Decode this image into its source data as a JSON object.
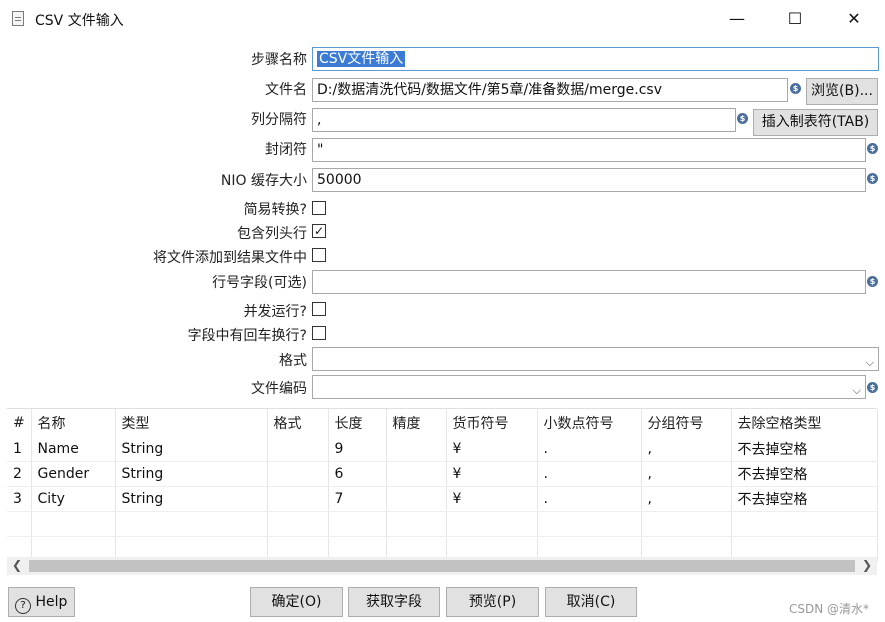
{
  "window": {
    "title": "CSV 文件输入",
    "minimize": "—",
    "maximize": "☐",
    "close": "✕"
  },
  "form": {
    "step_name_label": "步骤名称",
    "step_name_value": "CSV文件输入",
    "filename_label": "文件名",
    "filename_value": "D:/数据清洗代码/数据文件/第5章/准备数据/merge.csv",
    "browse_label": "浏览(B)...",
    "delimiter_label": "列分隔符",
    "delimiter_value": ",",
    "insert_tab_label": "插入制表符(TAB)",
    "enclosure_label": "封闭符",
    "enclosure_value": "\"",
    "nio_label": "NIO 缓存大小",
    "nio_value": "50000",
    "lazy_label": "简易转换?",
    "lazy_checked": false,
    "header_label": "包含列头行",
    "header_checked": true,
    "addfile_label": "将文件添加到结果文件中",
    "addfile_checked": false,
    "rownum_label": "行号字段(可选)",
    "rownum_value": "",
    "parallel_label": "并发运行?",
    "parallel_checked": false,
    "newline_label": "字段中有回车换行?",
    "newline_checked": false,
    "format_label": "格式",
    "format_value": "",
    "encoding_label": "文件编码",
    "encoding_value": ""
  },
  "grid": {
    "columns": [
      "#",
      "名称",
      "类型",
      "格式",
      "长度",
      "精度",
      "货币符号",
      "小数点符号",
      "分组符号",
      "去除空格类型"
    ],
    "rows": [
      [
        "1",
        "Name",
        "String",
        "",
        "9",
        "",
        "¥",
        ".",
        ",",
        "不去掉空格"
      ],
      [
        "2",
        "Gender",
        "String",
        "",
        "6",
        "",
        "¥",
        ".",
        ",",
        "不去掉空格"
      ],
      [
        "3",
        "City",
        "String",
        "",
        "7",
        "",
        "¥",
        ".",
        ",",
        "不去掉空格"
      ]
    ]
  },
  "buttons": {
    "help": "Help",
    "ok": "确定(O)",
    "get_fields": "获取字段",
    "preview": "预览(P)",
    "cancel": "取消(C)"
  },
  "watermark": "CSDN @清水*"
}
